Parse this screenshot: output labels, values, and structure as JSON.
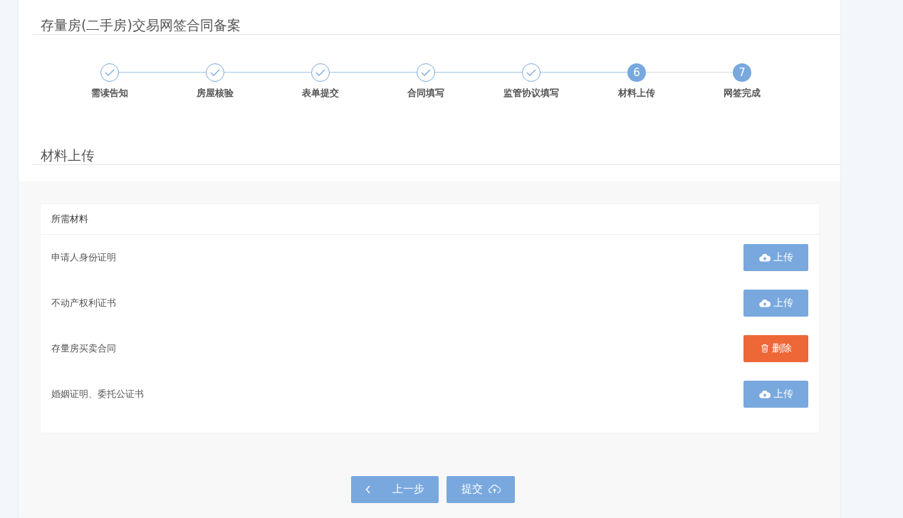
{
  "page_title": "存量房(二手房)交易网签合同备案",
  "steps": [
    {
      "label": "需读告知",
      "done": true
    },
    {
      "label": "房屋核验",
      "done": true
    },
    {
      "label": "表单提交",
      "done": true
    },
    {
      "label": "合同填写",
      "done": true
    },
    {
      "label": "监管协议填写",
      "done": true
    },
    {
      "label": "材料上传",
      "done": false,
      "number": "6"
    },
    {
      "label": "网签完成",
      "done": false,
      "number": "7"
    }
  ],
  "section_title": "材料上传",
  "materials": {
    "header": "所需材料",
    "rows": [
      {
        "name": "申请人身份证明",
        "action": {
          "kind": "upload",
          "label": "上传"
        }
      },
      {
        "name": "不动产权利证书",
        "action": {
          "kind": "upload",
          "label": "上传"
        }
      },
      {
        "name": "存量房买卖合同",
        "action": {
          "kind": "delete",
          "label": "删除"
        }
      },
      {
        "name": "婚姻证明、委托公证书",
        "action": {
          "kind": "upload",
          "label": "上传"
        }
      }
    ]
  },
  "footer_buttons": [
    {
      "kind": "back",
      "label": "上一步"
    },
    {
      "kind": "submit",
      "label": "提交"
    }
  ]
}
